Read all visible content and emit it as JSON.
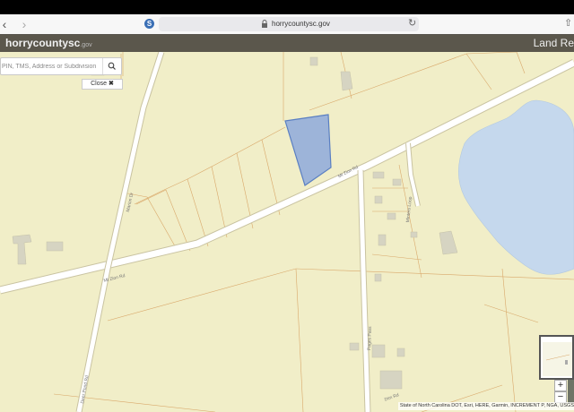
{
  "browser": {
    "url": "horrycountysc.gov",
    "site_badge": "S",
    "back": "‹",
    "forward": "›",
    "reload": "↻",
    "share": "⇧"
  },
  "header": {
    "logo_main": "horrycountysc",
    "logo_suffix": ".gov",
    "right_label": "Land Re"
  },
  "search": {
    "placeholder": "PIN, TMS, Address or Subdivision"
  },
  "close_button": {
    "label": "Close",
    "icon": "✖"
  },
  "map": {
    "road_labels": [
      "Mt Zion Rd",
      "Mt Zion Rd",
      "Marion Dr",
      "Minters Loop",
      "Pages Pass",
      "Deer Pond Rd",
      "Dim Rd"
    ],
    "selected_parcel_color": "#9db4d9",
    "water_color": "#c5d8ed"
  },
  "zoom": {
    "in": "+",
    "out": "−"
  },
  "attribution": "State of North Carolina DOT, Esri, HERE, Garmin, INCREMENT P, NGA, USGS"
}
